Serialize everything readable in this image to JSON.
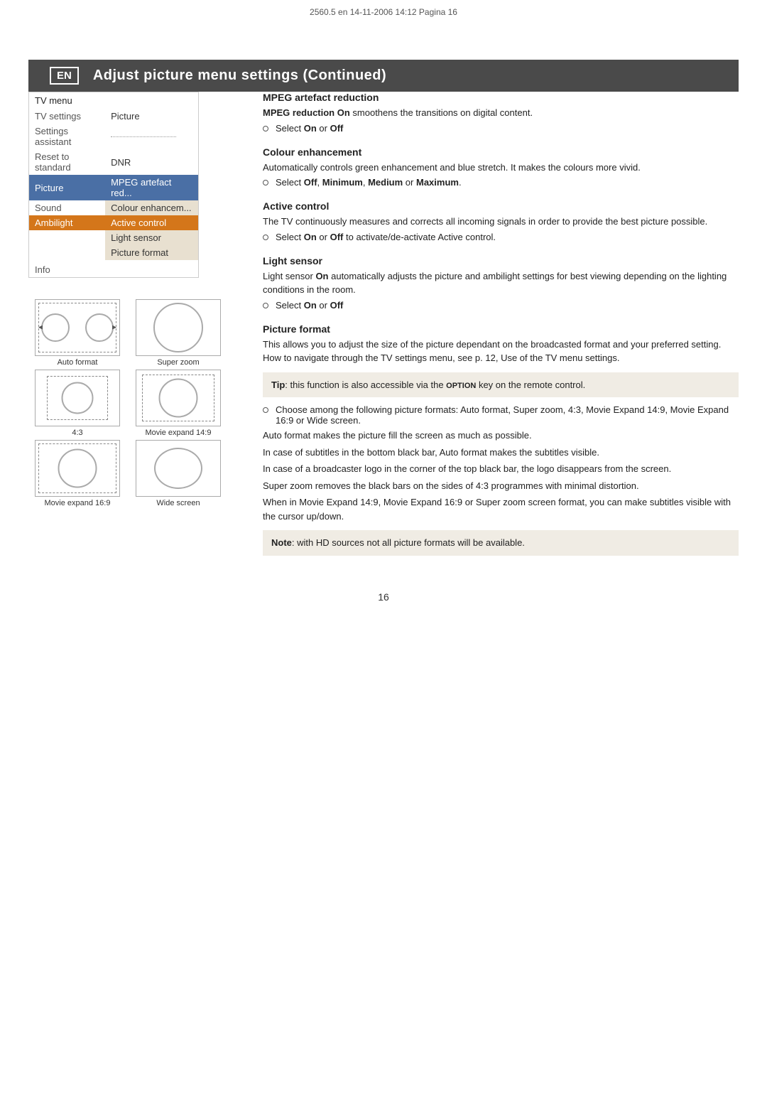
{
  "print_meta": "2560.5 en  14-11-2006  14:12  Pagina 16",
  "header": {
    "en_badge": "EN",
    "title": "Adjust picture menu settings  (Continued)"
  },
  "tv_menu": {
    "title": "TV menu",
    "rows": [
      {
        "left": "TV settings",
        "right": "Picture",
        "style": "header"
      },
      {
        "left": "Settings assistant",
        "right": "............",
        "style": "dotted"
      },
      {
        "left": "Reset to standard",
        "right": "DNR",
        "style": "sub"
      },
      {
        "left": "Picture",
        "right": "MPEG artefact red...",
        "style": "highlighted-blue"
      },
      {
        "left": "Sound",
        "right": "Colour enhancem...",
        "style": "sub"
      },
      {
        "left": "Ambilight",
        "right": "Active control",
        "style": "highlighted-orange"
      },
      {
        "left": "",
        "right": "Light sensor",
        "style": "sub"
      },
      {
        "left": "",
        "right": "Picture format",
        "style": "sub"
      },
      {
        "left": "Info",
        "right": "",
        "style": "info"
      }
    ]
  },
  "picture_formats": [
    {
      "label": "Auto format",
      "type": "auto"
    },
    {
      "label": "Super zoom",
      "type": "super"
    },
    {
      "label": "4:3",
      "type": "four3"
    },
    {
      "label": "Movie expand 14:9",
      "type": "movie14"
    },
    {
      "label": "Movie expand 16:9",
      "type": "movie16"
    },
    {
      "label": "Wide screen",
      "type": "wide"
    }
  ],
  "sections": {
    "mpeg": {
      "heading": "MPEG artefact reduction",
      "intro": "MPEG reduction On smoothens the transitions on digital content.",
      "bullet": "Select On or Off"
    },
    "colour": {
      "heading": "Colour enhancement",
      "intro": "Automatically controls green enhancement and blue stretch. It makes the colours more vivid.",
      "bullet": "Select Off, Minimum, Medium or Maximum."
    },
    "active": {
      "heading": "Active control",
      "intro": "The TV continuously measures and corrects all incoming signals in order to provide the best picture possible.",
      "bullet": "Select On or Off to activate/de-activate Active control."
    },
    "light": {
      "heading": "Light sensor",
      "intro": "Light sensor On automatically adjusts the picture and ambilight settings for best viewing depending on the lighting conditions in the room.",
      "bullet": "Select On or Off"
    },
    "picture_format": {
      "heading": "Picture format",
      "para1": "This allows you to adjust the size of the picture dependant on the broadcasted format and your preferred setting. How to navigate through the TV settings menu, see p. 12, Use of the TV menu settings.",
      "tip": {
        "bold_part": "Tip",
        "text": ": this function is also accessible via the OPTION key on the remote control."
      },
      "bullet": "Choose among the following picture formats: Auto format, Super zoom, 4:3, Movie Expand 14:9, Movie Expand 16:9 or Wide screen.",
      "para2": "Auto format makes the picture fill the screen as much as possible.",
      "para3": "In case of subtitles in the bottom black bar, Auto format makes the subtitles visible.",
      "para4": "In case of a broadcaster logo in the  corner of the top black bar, the logo disappears from the screen.",
      "para5": "Super zoom removes the black bars on the sides of 4:3 programmes with minimal distortion.",
      "para6": "When in Movie Expand 14:9, Movie Expand 16:9 or Super zoom screen format, you can make subtitles visible with the cursor up/down.",
      "note": {
        "bold_part": "Note",
        "text": ": with HD sources not all picture formats will be available."
      }
    }
  },
  "page_number": "16"
}
